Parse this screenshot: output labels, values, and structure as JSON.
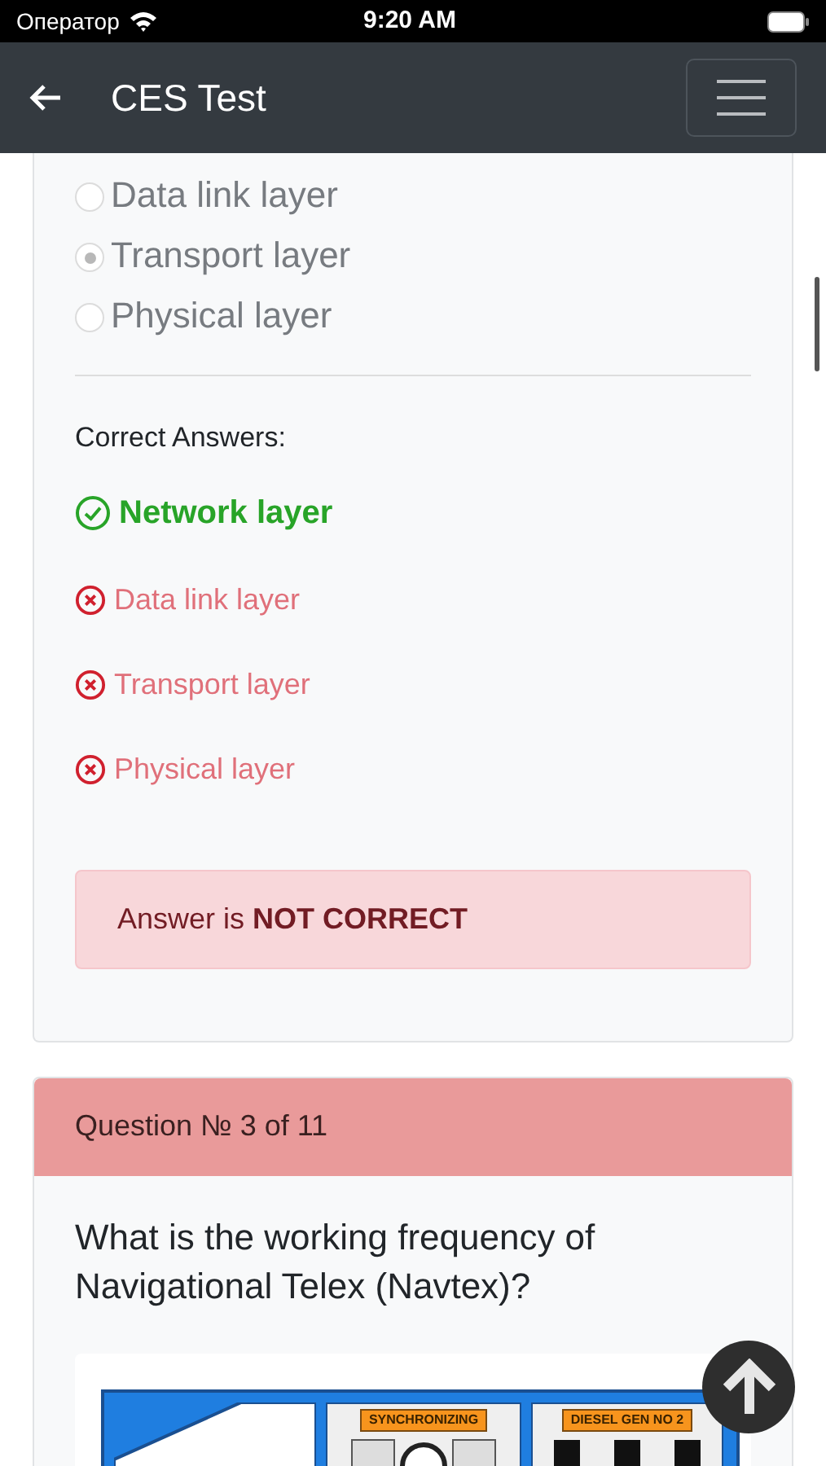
{
  "status_bar": {
    "carrier": "Оператор",
    "time": "9:20 AM"
  },
  "header": {
    "title": "CES Test"
  },
  "question_2": {
    "options": [
      {
        "label": "Data link layer",
        "selected": false
      },
      {
        "label": "Transport layer",
        "selected": true
      },
      {
        "label": "Physical layer",
        "selected": false
      }
    ],
    "answers_heading": "Correct Answers:",
    "answers": [
      {
        "label": "Network layer",
        "correct": true
      },
      {
        "label": "Data link layer",
        "correct": false
      },
      {
        "label": "Transport layer",
        "correct": false
      },
      {
        "label": "Physical layer",
        "correct": false
      }
    ],
    "result": "Answer is **NOT CORRECT**"
  },
  "question_3": {
    "heading": "Question № 3 of 11",
    "text": "What is the working frequency of Navigational Telex (Navtex)?",
    "image": {
      "labels": [
        "SYNCHRONIZING",
        "DIESEL GEN NO 2"
      ]
    }
  }
}
